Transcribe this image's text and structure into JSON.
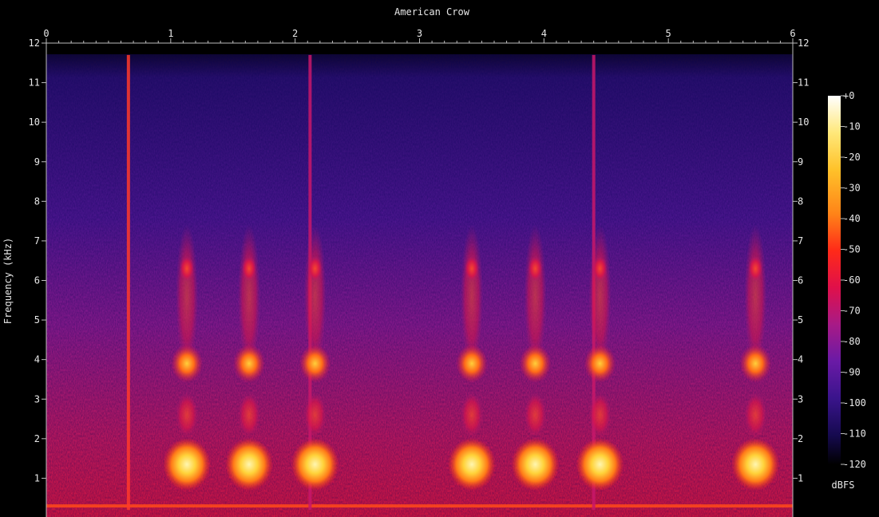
{
  "chart_data": {
    "type": "heatmap",
    "title": "American Crow",
    "xlabel": "",
    "ylabel": "Frequency (kHz)",
    "x_ticks": [
      "0",
      "1",
      "2",
      "3",
      "4",
      "5",
      "6"
    ],
    "y_ticks": [
      "1",
      "2",
      "3",
      "4",
      "5",
      "6",
      "7",
      "8",
      "9",
      "10",
      "11",
      "12"
    ],
    "xlim": [
      0,
      6
    ],
    "ylim": [
      0,
      12
    ],
    "colorbar": {
      "label": "dBFS",
      "ticks": [
        "+0",
        "-10",
        "-20",
        "-30",
        "-40",
        "-50",
        "-60",
        "-70",
        "-80",
        "-90",
        "-100",
        "-110",
        "-120"
      ],
      "range": [
        -120,
        0
      ],
      "colors": [
        "#000000",
        "#1a0a4a",
        "#3b0f8a",
        "#7b1ba8",
        "#b5227a",
        "#e8154a",
        "#ff3b1f",
        "#ff8c1a",
        "#ffd23a",
        "#ffffff"
      ]
    },
    "calls": [
      {
        "t": 1.13,
        "dbfs": -18
      },
      {
        "t": 1.63,
        "dbfs": -18
      },
      {
        "t": 2.16,
        "dbfs": -18
      },
      {
        "t": 3.42,
        "dbfs": -18
      },
      {
        "t": 3.93,
        "dbfs": -18
      },
      {
        "t": 4.45,
        "dbfs": -18
      },
      {
        "t": 5.7,
        "dbfs": -20
      }
    ],
    "clicks": [
      {
        "t": 0.66,
        "dbfs": -45
      },
      {
        "t": 2.12,
        "dbfs": -55
      },
      {
        "t": 4.4,
        "dbfs": -55
      }
    ],
    "noise_line_khz": 0.3
  }
}
